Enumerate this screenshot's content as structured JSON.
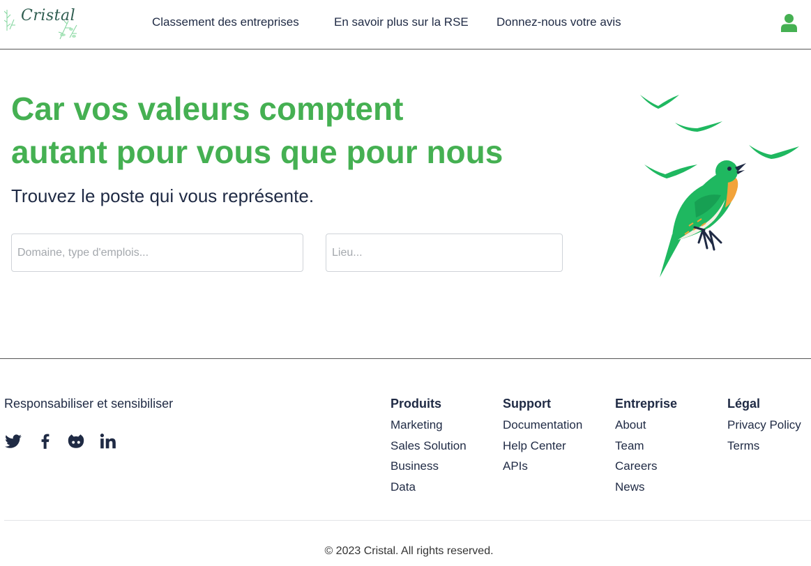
{
  "header": {
    "logo_text": "Cristal",
    "nav": [
      "Classement des entreprises",
      "En savoir plus sur la RSE",
      "Donnez-nous votre avis"
    ],
    "user_icon": "user-icon"
  },
  "hero": {
    "title_line1": "Car vos valeurs comptent",
    "title_line2": "autant pour vous que pour nous",
    "subtitle": "Trouvez le poste qui vous représente.",
    "search_domain_placeholder": "Domaine, type d'emplois...",
    "search_location_placeholder": "Lieu...",
    "illustration": "bird-with-flying-birds"
  },
  "footer": {
    "tagline": "Responsabiliser et sensibiliser",
    "socials": [
      "twitter-icon",
      "facebook-icon",
      "github-icon",
      "linkedin-icon"
    ],
    "columns": [
      {
        "title": "Produits",
        "links": [
          "Marketing",
          "Sales Solution",
          "Business",
          "Data"
        ]
      },
      {
        "title": "Support",
        "links": [
          "Documentation",
          "Help Center",
          "APIs"
        ]
      },
      {
        "title": "Entreprise",
        "links": [
          "About",
          "Team",
          "Careers",
          "News"
        ]
      },
      {
        "title": "Légal",
        "links": [
          "Privacy Policy",
          "Terms"
        ]
      }
    ],
    "copyright": "© 2023 Cristal. All rights reserved."
  },
  "colors": {
    "accent_green": "#45b052",
    "text_dark": "#1f2a44",
    "bird_green": "#1fb860",
    "bird_orange": "#f2a33a"
  }
}
